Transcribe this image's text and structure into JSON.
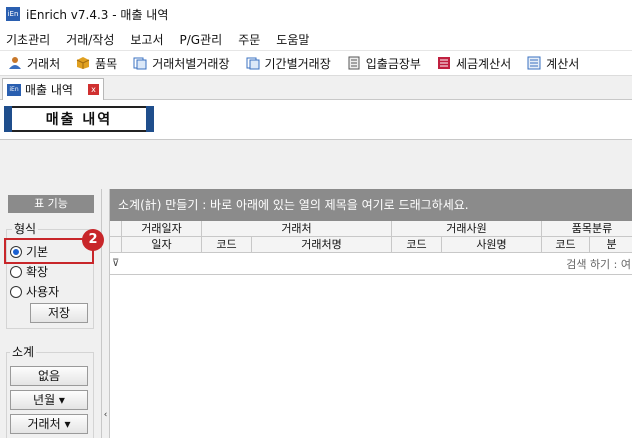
{
  "window": {
    "title": "iEnrich v7.4.3 - 매출 내역",
    "logo_text": "iEn"
  },
  "menu": [
    "기초관리",
    "거래/작성",
    "보고서",
    "P/G관리",
    "주문",
    "도움말"
  ],
  "toolbar": {
    "items": [
      {
        "label": "거래처",
        "icon": "person-icon",
        "color": "#c8782a"
      },
      {
        "label": "품목",
        "icon": "box-icon",
        "color": "#e0a020"
      },
      {
        "label": "거래처별거래장",
        "icon": "ledger-icon",
        "color": "#3a70c0"
      },
      {
        "label": "기간별거래장",
        "icon": "ledger-icon",
        "color": "#3a70c0"
      },
      {
        "label": "입출금장부",
        "icon": "book-icon",
        "color": "#555555"
      },
      {
        "label": "세금계산서",
        "icon": "invoice-icon",
        "color": "#c02040"
      },
      {
        "label": "계산서",
        "icon": "document-icon",
        "color": "#3a70c0"
      }
    ]
  },
  "tab": {
    "label": "매출 내역",
    "logo_text": "iEn",
    "close": "x"
  },
  "page_title": "매출 내역",
  "left_panel": {
    "header": "표 기능",
    "format_group": {
      "label": "형식",
      "options": [
        {
          "label": "기본",
          "selected": true
        },
        {
          "label": "확장",
          "selected": false
        },
        {
          "label": "사용자",
          "selected": false
        }
      ],
      "save_label": "저장"
    },
    "subtotal_group": {
      "label": "소계",
      "buttons": [
        "없음",
        "년월 ▾",
        "거래처 ▾"
      ]
    },
    "collapse": "‹"
  },
  "annotation": {
    "badge": "2",
    "color": "#c8262a"
  },
  "grid": {
    "group_hint": "소계(計) 만들기 : 바로 아래에 있는 열의 제목을 여기로 드래그하세요.",
    "band_headers": [
      "거래일자",
      "거래처",
      "거래사원",
      "품목분류"
    ],
    "column_headers": [
      "일자",
      "코드",
      "거래처명",
      "코드",
      "사원명",
      "코드",
      "분"
    ],
    "filter_icon": "⊽",
    "search_hint": "검색 하기 : 여"
  }
}
